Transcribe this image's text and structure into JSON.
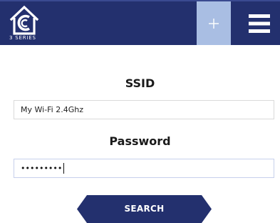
{
  "header": {
    "logo_text": "3 SERIES",
    "logo_icon": "house-c-logo",
    "add_icon": "plus-icon",
    "menu_icon": "hamburger-menu-icon"
  },
  "form": {
    "ssid_label": "SSID",
    "ssid_value": "My Wi-Fi 2.4Ghz",
    "password_label": "Password",
    "password_masked": "•••••••••",
    "search_label": "SEARCH"
  },
  "colors": {
    "header_bg": "#23306e",
    "add_button_bg": "#a9bee3",
    "search_button_bg": "#23306e",
    "text": "#1a1a1a"
  }
}
